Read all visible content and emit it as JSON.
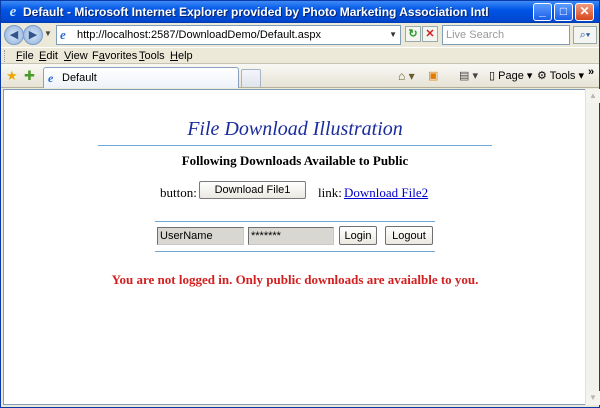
{
  "window": {
    "title": "Default - Microsoft Internet Explorer provided by Photo Marketing Association Intl"
  },
  "address_bar": {
    "url": "http://localhost:2587/DownloadDemo/Default.aspx",
    "search_placeholder": "Live Search"
  },
  "menu": {
    "items": [
      {
        "accel": "F",
        "rest": "ile"
      },
      {
        "accel": "E",
        "rest": "dit"
      },
      {
        "accel": "V",
        "rest": "iew"
      },
      {
        "accel": "",
        "pre": "F",
        "accel2": "a",
        "rest": "vorites"
      },
      {
        "accel": "T",
        "rest": "ools"
      },
      {
        "accel": "H",
        "rest": "elp"
      }
    ]
  },
  "tabs": {
    "active_label": "Default"
  },
  "command_bar": {
    "page_label": "Page",
    "tools_label": "Tools"
  },
  "page": {
    "heading": "File Download Illustration",
    "subheading": "Following Downloads Available to Public",
    "button_label": "button:",
    "download1_label": "Download File1",
    "link_label": "link:",
    "download2_label": "Download File2",
    "username_value": "UserName",
    "password_value": "*******",
    "login_label": "Login",
    "logout_label": "Logout",
    "status_message": "You are not logged in. Only public downloads are avaialble to you."
  },
  "colors": {
    "heading": "#1a2d9a",
    "status": "#d22020",
    "link": "#0000cc",
    "rule": "#6fa8d6"
  }
}
